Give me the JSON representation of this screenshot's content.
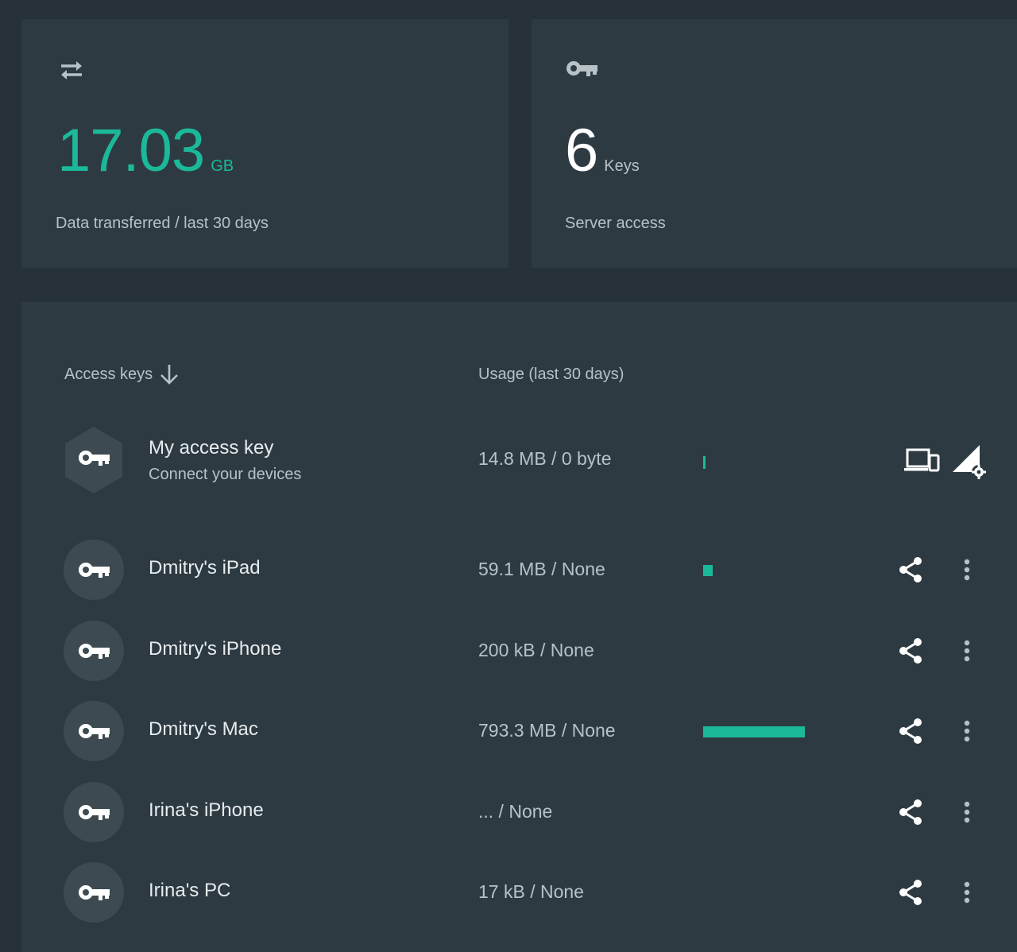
{
  "transfer": {
    "icon": "swap-arrows-icon",
    "value": "17.03",
    "unit": "GB",
    "label": "Data transferred / last 30 days",
    "accent": "#1bb99a"
  },
  "keys_count": {
    "icon": "key-icon",
    "value": "6",
    "unit": "Keys",
    "label": "Server access"
  },
  "list": {
    "header_keys": "Access keys",
    "header_usage": "Usage (last 30 days)",
    "sort_icon": "arrow-down-icon",
    "rows": [
      {
        "name": "My access key",
        "subtitle": "Connect your devices",
        "usage": "14.8 MB / 0 byte",
        "usage_fraction": 0.015,
        "is_owner": true
      },
      {
        "name": "Dmitry's iPad",
        "usage": "59.1 MB / None",
        "usage_fraction": 0.06
      },
      {
        "name": "Dmitry's iPhone",
        "usage": "200 kB / None",
        "usage_fraction": 0
      },
      {
        "name": "Dmitry's Mac",
        "usage": "793.3 MB / None",
        "usage_fraction": 0.64
      },
      {
        "name": "Irina's iPhone",
        "usage": "... / None",
        "usage_fraction": 0
      },
      {
        "name": "Irina's PC",
        "usage": "17 kB / None",
        "usage_fraction": 0
      }
    ]
  }
}
